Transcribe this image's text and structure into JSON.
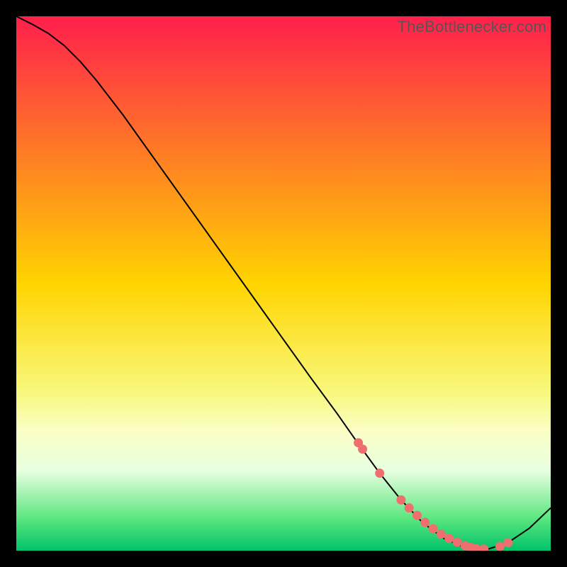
{
  "watermark": "TheBottlenecker.com",
  "chart_data": {
    "type": "line",
    "title": "",
    "xlabel": "",
    "ylabel": "",
    "xlim": [
      0,
      100
    ],
    "ylim": [
      0,
      100
    ],
    "grid": false,
    "legend": false,
    "background_gradient": {
      "stops": [
        {
          "t": 0.0,
          "color": "#ff1f4c"
        },
        {
          "t": 0.5,
          "color": "#ffd400"
        },
        {
          "t": 0.7,
          "color": "#f8f87a"
        },
        {
          "t": 0.78,
          "color": "#faffc8"
        },
        {
          "t": 0.85,
          "color": "#e8ffe0"
        },
        {
          "t": 0.94,
          "color": "#5ae67f"
        },
        {
          "t": 1.0,
          "color": "#00c26a"
        }
      ]
    },
    "series": [
      {
        "name": "curve",
        "color": "#000000",
        "width": 2,
        "x": [
          0,
          3,
          6,
          9,
          12,
          15,
          20,
          25,
          30,
          35,
          40,
          45,
          50,
          55,
          60,
          64,
          68,
          72,
          76,
          80,
          84,
          88,
          92,
          96,
          100
        ],
        "y": [
          100,
          98.5,
          96.8,
          94.5,
          91.5,
          88,
          81.5,
          74.5,
          67.5,
          60.5,
          53.5,
          46.5,
          39.5,
          32.5,
          25.7,
          20,
          14.5,
          9.5,
          5.3,
          2.3,
          0.6,
          0.2,
          1.5,
          4.2,
          8.0
        ]
      }
    ],
    "points": {
      "name": "highlight-dots",
      "color": "#ef6f6f",
      "radius": 6.5,
      "x": [
        64.0,
        64.8,
        68.0,
        72.0,
        73.5,
        75.0,
        76.5,
        78.0,
        79.5,
        81.0,
        82.5,
        84.0,
        85.0,
        86.0,
        87.5,
        90.5,
        92.0
      ],
      "y": [
        20.2,
        19.0,
        14.5,
        9.5,
        8.0,
        6.6,
        5.3,
        4.1,
        3.1,
        2.3,
        1.6,
        0.9,
        0.6,
        0.4,
        0.3,
        0.8,
        1.5
      ]
    }
  }
}
